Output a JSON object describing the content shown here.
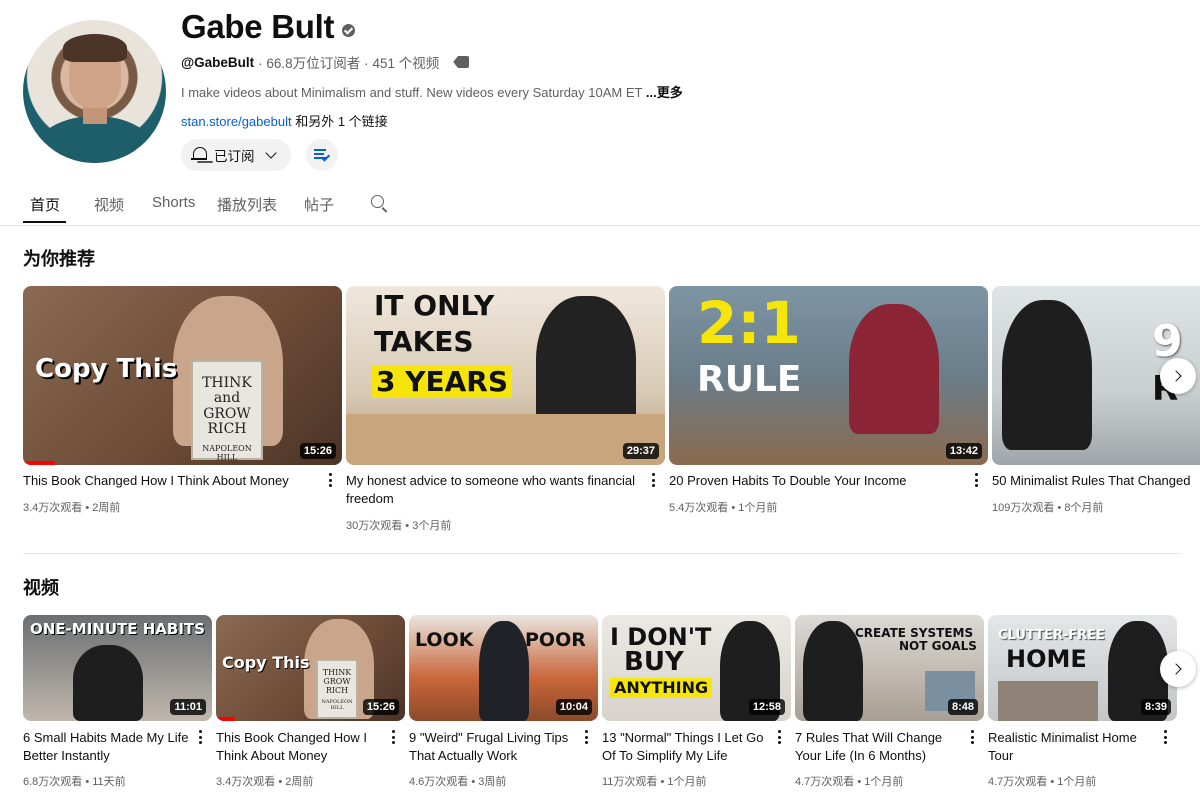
{
  "channel": {
    "name": "Gabe Bult",
    "handle": "@GabeBult",
    "subscribers": "· 66.8万位订阅者 ·",
    "video_count": "451 个视频",
    "description": "I make videos about Minimalism and stuff. New videos every Saturday 10AM ET",
    "more_label": "...更多",
    "link": "stan.store/gabebult",
    "link_suffix": "和另外 1 个链接",
    "subscribed_label": "已订阅"
  },
  "tabs": [
    "首页",
    "视频",
    "Shorts",
    "播放列表",
    "帖子"
  ],
  "sections": {
    "recommended": "为你推荐",
    "videos": "视频"
  },
  "recommended": [
    {
      "title": "This Book Changed How I Think About Money",
      "meta": "3.4万次观看 • 2周前",
      "duration": "15:26",
      "overlay": "Copy This",
      "book_title": "THINK and GROW RICH",
      "book_author": "NAPOLEON HILL"
    },
    {
      "title": "My honest advice to someone who wants financial freedom",
      "meta": "30万次观看 • 3个月前",
      "duration": "29:37",
      "overlay_1": "IT ONLY",
      "overlay_2": "TAKES",
      "overlay_3": "3 YEARS"
    },
    {
      "title": "20 Proven Habits To Double Your Income",
      "meta": "5.4万次观看 • 1个月前",
      "duration": "13:42",
      "overlay_1": "2:1",
      "overlay_2": "RULE"
    },
    {
      "title": "50 Minimalist Rules That Changed",
      "meta": "109万次观看 • 8个月前",
      "duration": "",
      "overlay_1": "9",
      "overlay_2": "R"
    }
  ],
  "videos": [
    {
      "title": "6 Small Habits Made My Life Better Instantly",
      "meta": "6.8万次观看 • 11天前",
      "duration": "11:01",
      "overlay": "ONE-MINUTE HABITS"
    },
    {
      "title": "This Book Changed How I Think About Money",
      "meta": "3.4万次观看 • 2周前",
      "duration": "15:26",
      "overlay": "Copy This",
      "book_title": "THINK GROW RICH",
      "book_author": "NAPOLEON HILL"
    },
    {
      "title": "9 \"Weird\" Frugal Living Tips That Actually Work",
      "meta": "4.6万次观看 • 3周前",
      "duration": "10:04",
      "overlay_1": "LOOK",
      "overlay_2": "POOR"
    },
    {
      "title": "13 \"Normal\" Things I Let Go Of To Simplify My Life",
      "meta": "11万次观看 • 1个月前",
      "duration": "12:58",
      "overlay_1": "I DON'T",
      "overlay_2": "BUY",
      "overlay_3": "ANYTHING"
    },
    {
      "title": "7 Rules That Will Change Your Life (In 6 Months)",
      "meta": "4.7万次观看 • 1个月前",
      "duration": "8:48",
      "overlay_1": "CREATE SYSTEMS",
      "overlay_2": "NOT GOALS"
    },
    {
      "title": "Realistic Minimalist Home Tour",
      "meta": "4.7万次观看 • 1个月前",
      "duration": "8:39",
      "overlay_1": "CLUTTER-FREE",
      "overlay_2": "HOME"
    }
  ],
  "colors": {
    "link": "#065fd4",
    "text_secondary": "#606060",
    "progress": "#ff0000",
    "highlight_yellow": "#f5e50a"
  },
  "icons": [
    "verified-icon",
    "tag-icon",
    "bell-icon",
    "chevron-down-icon",
    "playlist-check-icon",
    "search-icon",
    "more-vert-icon",
    "chevron-right-icon"
  ]
}
